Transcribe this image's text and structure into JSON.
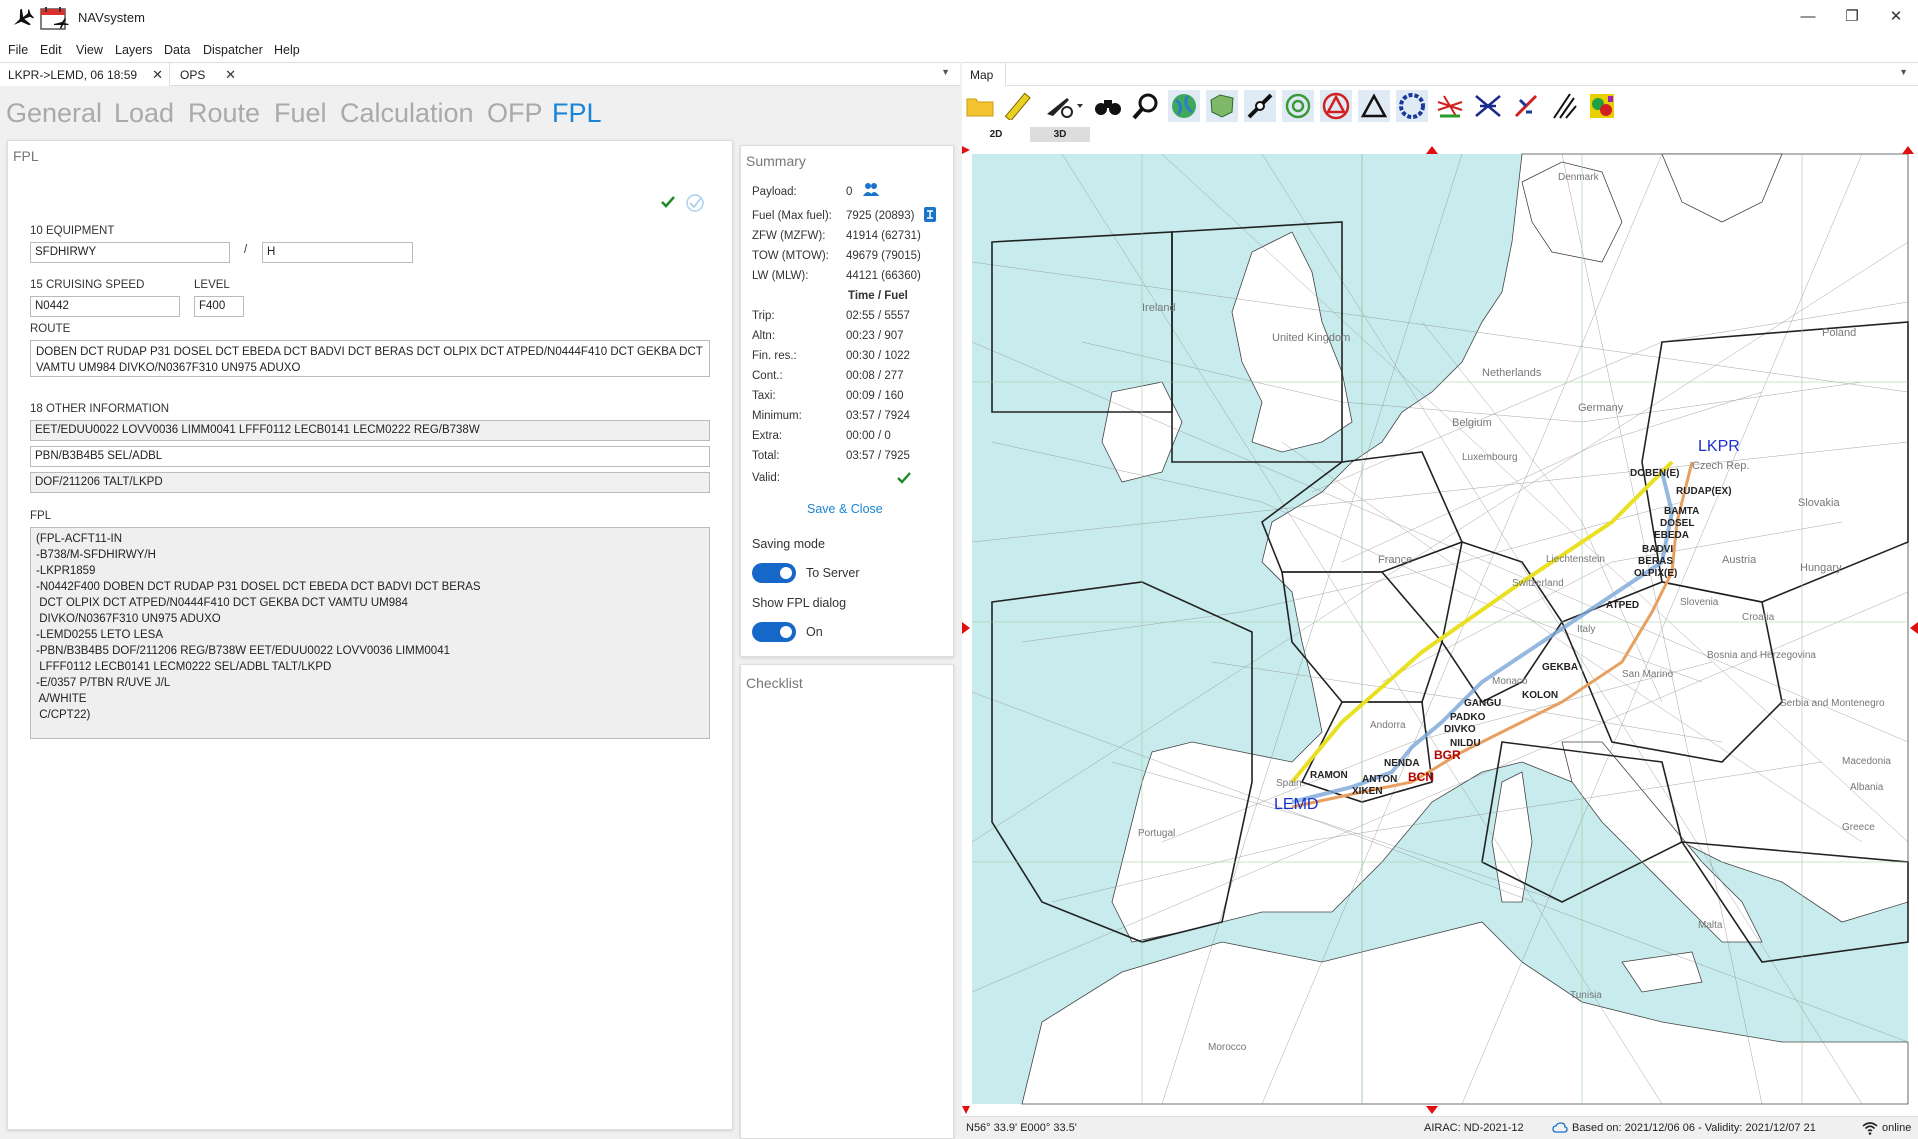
{
  "window": {
    "title": "NAVsystem",
    "min": "—",
    "max": "❐",
    "close": "✕"
  },
  "menu": [
    "File",
    "Edit",
    "View",
    "Layers",
    "Data",
    "Dispatcher",
    "Help"
  ],
  "doc_tabs": [
    {
      "label": "LKPR->LEMD, 06 18:59"
    },
    {
      "label": "OPS"
    }
  ],
  "section_tabs": [
    "General",
    "Load",
    "Route",
    "Fuel",
    "Calculation",
    "OFP",
    "FPL"
  ],
  "active_section": "FPL",
  "fpl": {
    "panel_title": "FPL",
    "equipment_label": "10 EQUIPMENT",
    "equipment_value": "SFDHIRWY",
    "equipment_sep": "/",
    "equipment_value2": "H",
    "speed_label": "15 CRUISING SPEED",
    "speed_value": "N0442",
    "level_label": "LEVEL",
    "level_value": "F400",
    "route_label": "ROUTE",
    "route_value": "DOBEN DCT RUDAP P31 DOSEL DCT EBEDA DCT BADVI DCT BERAS DCT OLPIX DCT ATPED/N0444F410 DCT GEKBA DCT\nVAMTU UM984 DIVKO/N0367F310 UN975 ADUXO",
    "other_label": "18 OTHER INFORMATION",
    "other_values": [
      "EET/EDUU0022 LOVV0036 LIMM0041 LFFF0112 LECB0141 LECM0222 REG/B738W",
      "PBN/B3B4B5 SEL/ADBL",
      "DOF/211206 TALT/LKPD"
    ],
    "fpl_label": "FPL",
    "fpl_text": "(FPL-ACFT11-IN\n-B738/M-SFDHIRWY/H\n-LKPR1859\n-N0442F400 DOBEN DCT RUDAP P31 DOSEL DCT EBEDA DCT BADVI DCT BERAS\n DCT OLPIX DCT ATPED/N0444F410 DCT GEKBA DCT VAMTU UM984\n DIVKO/N0367F310 UN975 ADUXO\n-LEMD0255 LETO LESA\n-PBN/B3B4B5 DOF/211206 REG/B738W EET/EDUU0022 LOVV0036 LIMM0041\n LFFF0112 LECB0141 LECM0222 SEL/ADBL TALT/LKPD\n-E/0357 P/TBN R/UVE J/L\n A/WHITE\n C/CPT22)"
  },
  "summary": {
    "title": "Summary",
    "rows": [
      {
        "label": "Payload:",
        "value": "0"
      },
      {
        "label": "Fuel (Max fuel):",
        "value": "7925 (20893)"
      },
      {
        "label": "ZFW (MZFW):",
        "value": "41914 (62731)"
      },
      {
        "label": "TOW (MTOW):",
        "value": "49679 (79015)"
      },
      {
        "label": "LW (MLW):",
        "value": "44121 (66360)"
      }
    ],
    "time_fuel_header": "Time  /  Fuel",
    "fuel_rows": [
      {
        "label": "Trip:",
        "value": "02:55 / 5557"
      },
      {
        "label": "Altn:",
        "value": "00:23 / 907"
      },
      {
        "label": "Fin. res.:",
        "value": "00:30 / 1022"
      },
      {
        "label": "Cont.:",
        "value": "00:08 / 277"
      },
      {
        "label": "Taxi:",
        "value": "00:09 / 160"
      },
      {
        "label": "Minimum:",
        "value": "03:57 / 7924"
      },
      {
        "label": "Extra:",
        "value": "00:00 / 0"
      },
      {
        "label": "Total:",
        "value": "03:57 / 7925"
      }
    ],
    "valid_label": "Valid:",
    "save_close": "Save & Close",
    "saving_mode_label": "Saving mode",
    "saving_mode_value": "To Server",
    "show_fpl_label": "Show FPL dialog",
    "show_fpl_value": "On"
  },
  "checklist": {
    "title": "Checklist"
  },
  "map": {
    "tab_label": "Map",
    "view_tabs": [
      "2D",
      "3D"
    ],
    "countries": [
      "Denmark",
      "Ireland",
      "United Kingdom",
      "Netherlands",
      "Belgium",
      "Luxembourg",
      "Germany",
      "Poland",
      "Czech Rep.",
      "Slovakia",
      "Austria",
      "Hungary",
      "France",
      "Switzerland",
      "Liechtenstein",
      "Slovenia",
      "Croatia",
      "Italy",
      "San Marino",
      "Bosnia and Herzegovina",
      "Serbia and Montenegro",
      "Monaco",
      "Andorra",
      "Spain",
      "Portugal",
      "Macedonia",
      "Albania",
      "Greece",
      "Malta",
      "Tunisia",
      "Morocco"
    ],
    "airports": [
      {
        "code": "LKPR",
        "color": "#1a2fd0"
      },
      {
        "code": "LEMD",
        "color": "#1a2fd0"
      },
      {
        "code": "BGR",
        "color": "#b00000"
      },
      {
        "code": "BCN",
        "color": "#b00000"
      }
    ],
    "waypoints": [
      "DOBEN(E)",
      "RUDAP(EX)",
      "BAMTA",
      "DOSEL",
      "EBEDA",
      "BADVI",
      "BERAS",
      "OLPIX(E)",
      "ATPED",
      "GEKBA",
      "KOLON",
      "GANGU",
      "PADKO",
      "DIVKO",
      "NILDU",
      "NENDA",
      "RAMON",
      "ANTON",
      "XIKEN"
    ],
    "route_color_main": "#e8e020",
    "route_color_alt": "#e8a060",
    "route_color_blue": "#7aa6d8"
  },
  "status": {
    "coords": "N56° 33.9'  E000° 33.5'",
    "airac": "AIRAC: ND-2021-12",
    "based_on": "Based on: 2021/12/06 06 - Validity: 2021/12/07 21",
    "online": "online"
  }
}
